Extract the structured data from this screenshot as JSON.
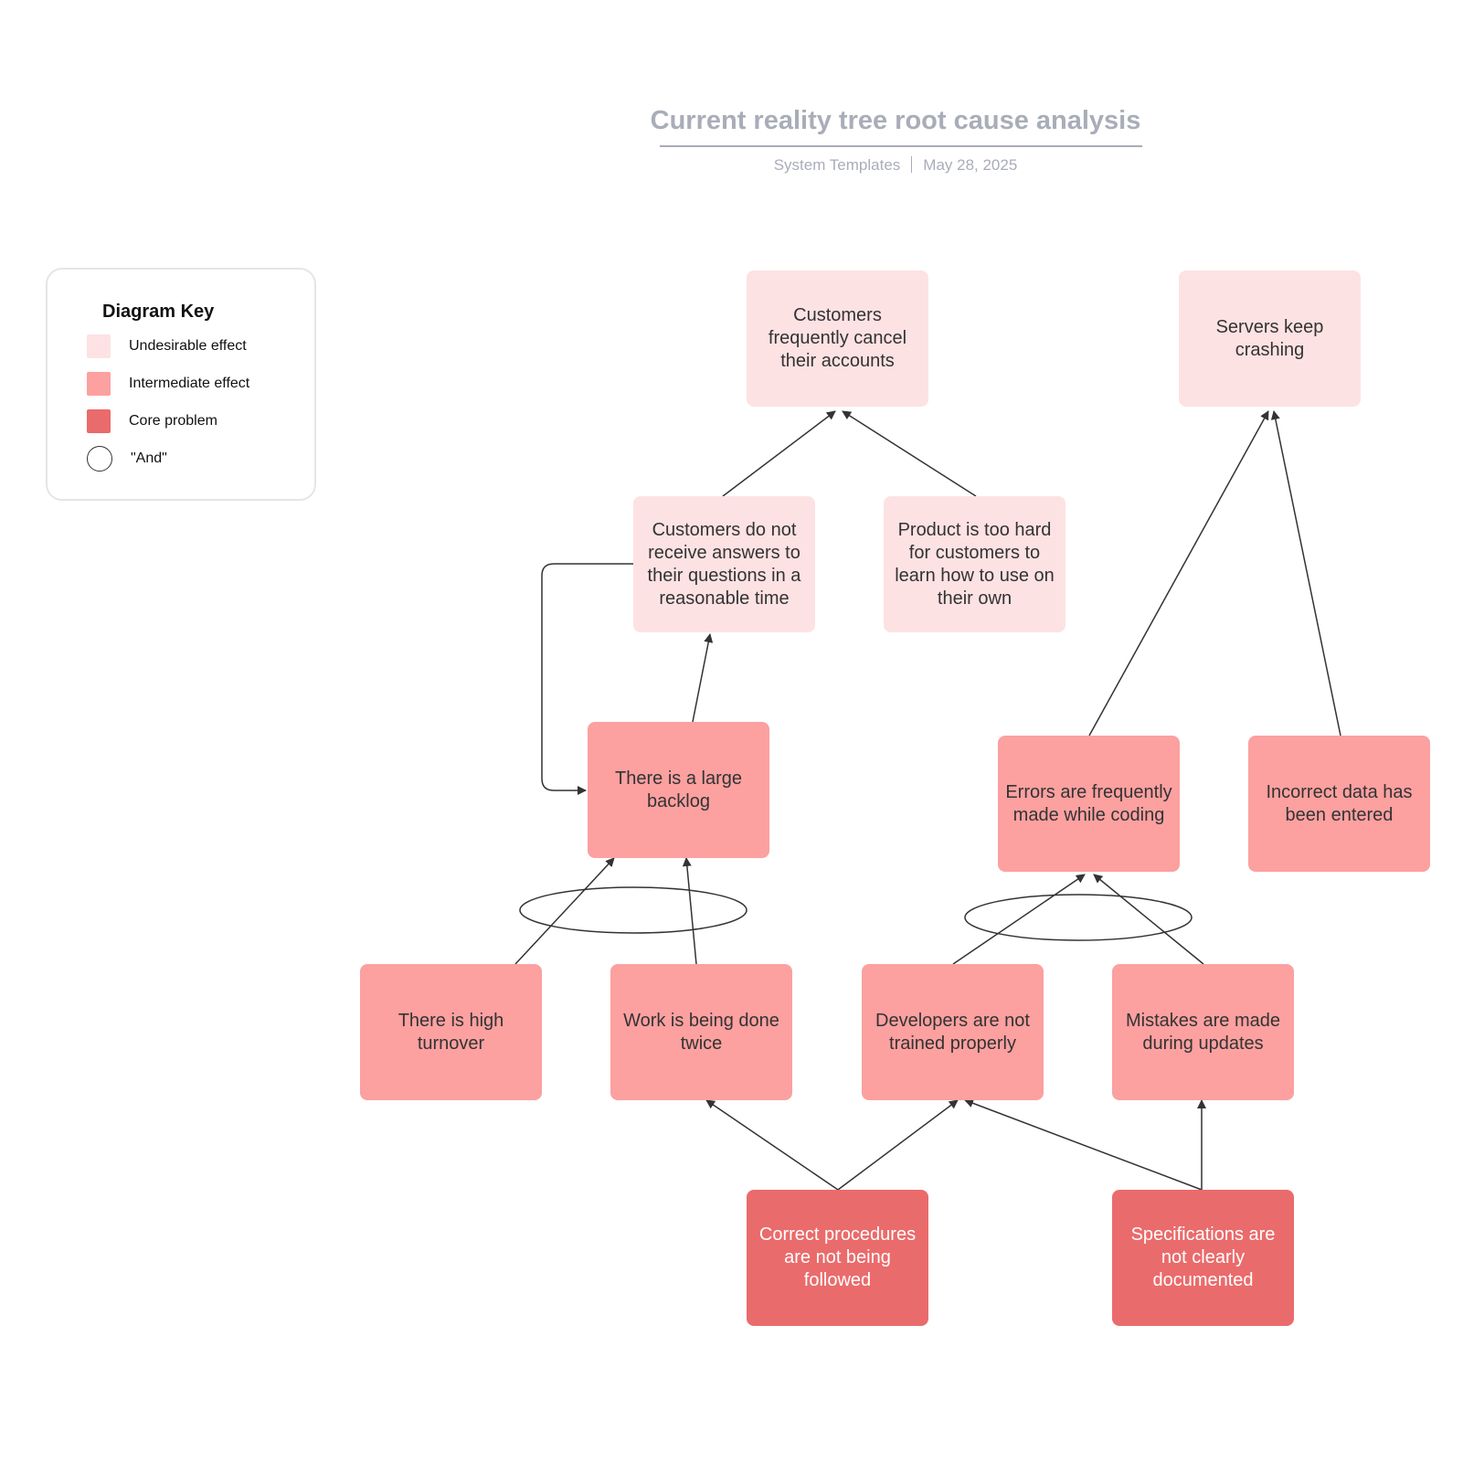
{
  "header": {
    "title": "Current reality tree root cause analysis",
    "author": "System Templates",
    "date": "May 28, 2025"
  },
  "colors": {
    "undesirable_effect": "#fde2e3",
    "intermediate_effect": "#fca0a0",
    "core_problem": "#ea6b6b",
    "connector": "#333333",
    "title": "#a9adb8"
  },
  "key": {
    "title": "Diagram Key",
    "items": [
      {
        "type": "undesirable_effect",
        "label": "Undesirable effect"
      },
      {
        "type": "intermediate_effect",
        "label": "Intermediate effect"
      },
      {
        "type": "core_problem",
        "label": "Core problem"
      },
      {
        "type": "and",
        "label": "\"And\""
      }
    ]
  },
  "nodes": [
    {
      "id": "cancel",
      "type": "undesirable_effect",
      "label": "Customers frequently cancel their accounts"
    },
    {
      "id": "servers",
      "type": "undesirable_effect",
      "label": "Servers keep crashing"
    },
    {
      "id": "answers",
      "type": "undesirable_effect",
      "label": "Customers do not receive answers to their questions in a reasonable time"
    },
    {
      "id": "hard",
      "type": "undesirable_effect",
      "label": "Product is too hard for customers to learn how to use on their own"
    },
    {
      "id": "backlog",
      "type": "intermediate_effect",
      "label": "There is a large backlog"
    },
    {
      "id": "errors",
      "type": "intermediate_effect",
      "label": "Errors are frequently made while coding"
    },
    {
      "id": "incorrect",
      "type": "intermediate_effect",
      "label": "Incorrect data has been entered"
    },
    {
      "id": "turnover",
      "type": "intermediate_effect",
      "label": "There is high turnover"
    },
    {
      "id": "twice",
      "type": "intermediate_effect",
      "label": "Work is being done twice"
    },
    {
      "id": "trained",
      "type": "intermediate_effect",
      "label": "Developers are not trained properly"
    },
    {
      "id": "mistakes",
      "type": "intermediate_effect",
      "label": "Mistakes are made during updates"
    },
    {
      "id": "procedures",
      "type": "core_problem",
      "label": "Correct procedures are not being followed"
    },
    {
      "id": "specs",
      "type": "core_problem",
      "label": "Specifications are not clearly documented"
    }
  ],
  "edges": [
    {
      "from": "answers",
      "to": "cancel"
    },
    {
      "from": "hard",
      "to": "cancel"
    },
    {
      "from": "backlog",
      "to": "answers"
    },
    {
      "from": "answers",
      "to": "backlog",
      "style": "elbow-loop"
    },
    {
      "from": "turnover",
      "to": "backlog",
      "and_group": 1
    },
    {
      "from": "twice",
      "to": "backlog",
      "and_group": 1
    },
    {
      "from": "errors",
      "to": "servers"
    },
    {
      "from": "incorrect",
      "to": "servers"
    },
    {
      "from": "trained",
      "to": "errors",
      "and_group": 2
    },
    {
      "from": "mistakes",
      "to": "errors",
      "and_group": 2
    },
    {
      "from": "procedures",
      "to": "twice"
    },
    {
      "from": "procedures",
      "to": "trained"
    },
    {
      "from": "specs",
      "to": "trained"
    },
    {
      "from": "specs",
      "to": "mistakes"
    }
  ]
}
